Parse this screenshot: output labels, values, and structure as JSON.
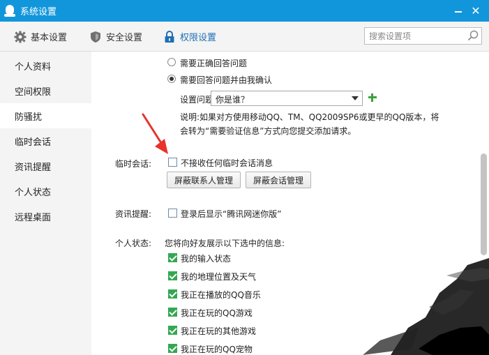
{
  "window": {
    "title": "系统设置"
  },
  "toolbar": {
    "tabs": [
      {
        "label": "基本设置",
        "icon": "gear-icon"
      },
      {
        "label": "安全设置",
        "icon": "shield-icon"
      },
      {
        "label": "权限设置",
        "icon": "lock-icon"
      }
    ],
    "search_placeholder": "搜索设置项"
  },
  "sidebar": {
    "items": [
      {
        "label": "个人资料"
      },
      {
        "label": "空间权限"
      },
      {
        "label": "防骚扰",
        "active": true
      },
      {
        "label": "临时会话"
      },
      {
        "label": "资讯提醒"
      },
      {
        "label": "个人状态"
      },
      {
        "label": "远程桌面"
      }
    ]
  },
  "anti_harass": {
    "radio_1": "需要正确回答问题",
    "radio_2": "需要回答问题并由我确认",
    "question_label": "设置问题一:",
    "question_value": "你是谁？",
    "note_line1": "说明:如果对方使用移动QQ、TM、QQ2009SP6或更早的QQ版本，将",
    "note_line2": "会转为“需要验证信息”方式向您提交添加请求。"
  },
  "temp_session": {
    "label": "临时会话:",
    "checkbox": "不接收任何临时会话消息",
    "btn_block_contacts": "屏蔽联系人管理",
    "btn_block_sessions": "屏蔽会话管理"
  },
  "news": {
    "label": "资讯提醒:",
    "checkbox": "登录后显示“腾讯网迷你版”"
  },
  "status": {
    "label": "个人状态:",
    "intro": "您将向好友展示以下选中的信息:",
    "items": [
      {
        "label": "我的输入状态",
        "checked": true
      },
      {
        "label": "我的地理位置及天气",
        "checked": true
      },
      {
        "label": "我正在播放的QQ音乐",
        "checked": true
      },
      {
        "label": "我正在玩的QQ游戏",
        "checked": true
      },
      {
        "label": "我正在玩的其他游戏",
        "checked": true
      },
      {
        "label": "我正在玩的QQ宠物",
        "checked": true
      }
    ]
  },
  "colors": {
    "titlebar": "#1296db",
    "accent": "#1f6fb5",
    "check_green": "#33a852",
    "annotation_red": "#e8322c"
  }
}
